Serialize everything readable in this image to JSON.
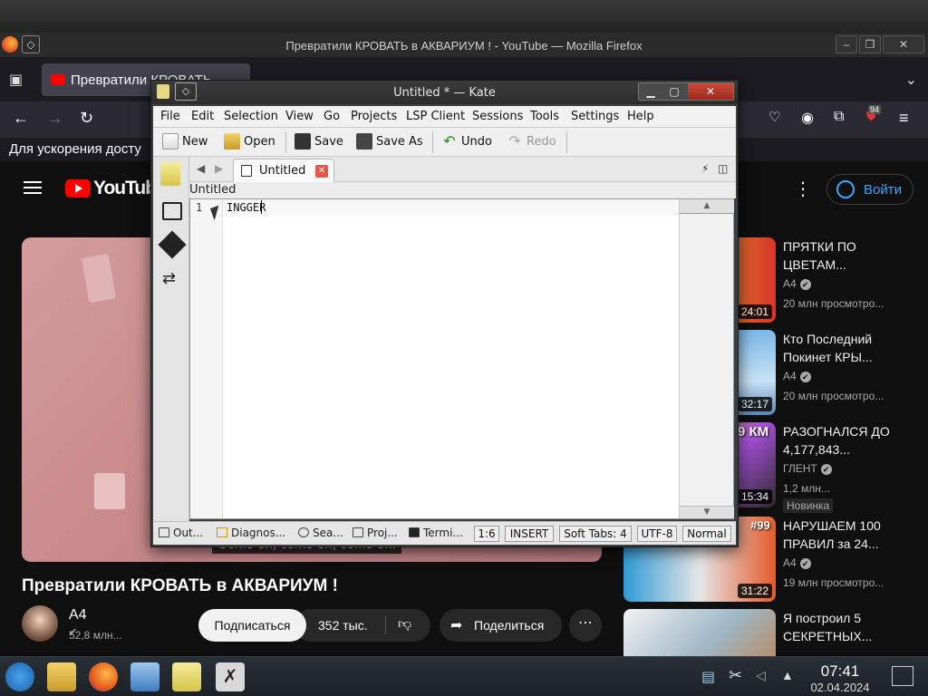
{
  "firefox": {
    "window_title": "Превратили КРОВАТЬ в АКВАРИУМ ! - YouTube — Mozilla Firefox",
    "tab_label": "Превратили КРОВАТЬ",
    "notice": "Для ускорения досту",
    "extension_badge": "94"
  },
  "youtube": {
    "logo_text": "YouTube",
    "signin_label": "Войти",
    "caption": "Come on, come on, come on!",
    "video_title": "Превратили КРОВАТЬ в АКВАРИУМ !",
    "channel_name": "A4",
    "channel_subs": "52,8 млн...",
    "subscribe_label": "Подписаться",
    "likes": "352 тыс.",
    "share_label": "Поделиться",
    "recommendations": [
      {
        "title": "ПРЯТКИ ПО ЦВЕТАМ...",
        "channel": "A4",
        "views": "20 млн просмотро...",
        "duration": "24:01"
      },
      {
        "title": "Кто Последний Покинет КРЫ...",
        "channel": "A4",
        "views": "20 млн просмотро...",
        "duration": "32:17"
      },
      {
        "title": "РАЗОГНАЛСЯ ДО 4,177,843...",
        "channel": "ГЛЕНТ",
        "views": "1,2 млн...",
        "duration": "15:34",
        "badge": "Новинка",
        "thumb_text": "9 КМ"
      },
      {
        "title": "НАРУШАЕМ 100 ПРАВИЛ за 24...",
        "channel": "A4",
        "views": "19 млн просмотро...",
        "duration": "31:22",
        "thumb_text": "#99"
      },
      {
        "title": "Я построил 5 СЕКРЕТНЫХ...",
        "channel": "",
        "views": "",
        "duration": ""
      }
    ]
  },
  "kate": {
    "window_title": "Untitled * — Kate",
    "menu": [
      "File",
      "Edit",
      "Selection",
      "View",
      "Go",
      "Projects",
      "LSP Client",
      "Sessions",
      "Tools",
      "Settings",
      "Help"
    ],
    "toolbar": {
      "new": "New",
      "open": "Open",
      "save": "Save",
      "save_as": "Save As",
      "undo": "Undo",
      "redo": "Redo"
    },
    "tab_label": "Untitled",
    "breadcrumb": "Untitled",
    "line_number": "1",
    "line_text": "INGGER",
    "status": {
      "output": "Out...",
      "diagnostics": "Diagnos...",
      "search": "Sea...",
      "projects": "Proj...",
      "terminal": "Termi...",
      "cursor": "1:6",
      "mode": "INSERT",
      "indent": "Soft Tabs: 4",
      "encoding": "UTF-8",
      "syntax": "Normal"
    }
  },
  "taskbar": {
    "time": "07:41",
    "date": "02.04.2024"
  },
  "colors": {
    "youtube_red": "#ff0000",
    "yt_link_blue": "#3ea6ff",
    "kate_close_red": "#c94a3a"
  }
}
